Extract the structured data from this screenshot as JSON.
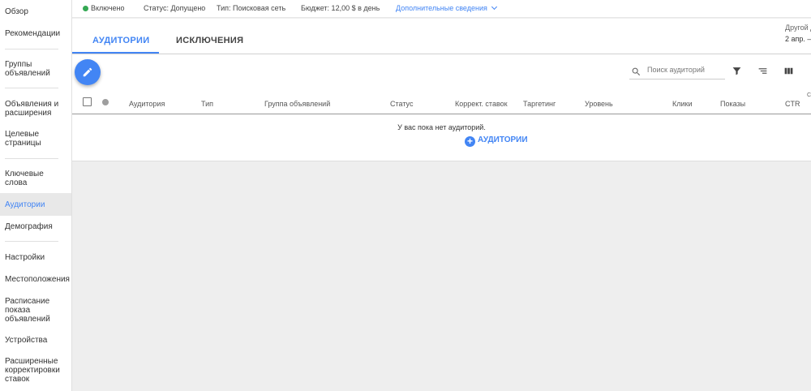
{
  "sidebar": {
    "items": [
      {
        "label": "Обзор"
      },
      {
        "label": "Рекомендации"
      },
      {
        "label": "Группы объявлений"
      },
      {
        "label": "Объявления и расширения"
      },
      {
        "label": "Целевые страницы"
      },
      {
        "label": "Ключевые слова"
      },
      {
        "label": "Аудитории"
      },
      {
        "label": "Демография"
      },
      {
        "label": "Настройки"
      },
      {
        "label": "Местоположения"
      },
      {
        "label": "Расписание показа объявлений"
      },
      {
        "label": "Устройства"
      },
      {
        "label": "Расширенные корректировки ставок"
      }
    ]
  },
  "status_bar": {
    "state": "Включено",
    "status": "Статус: Допущено",
    "type": "Тип: Поисковая сеть",
    "budget": "Бюджет: 12,00 $ в день",
    "more": "Дополнительные сведения"
  },
  "tabs": {
    "audiences": "АУДИТОРИИ",
    "exclusions": "ИСКЛЮЧЕНИЯ"
  },
  "date_range": {
    "label": "Другой д",
    "value": "2 апр. –"
  },
  "toolbar": {
    "search_placeholder": "Поиск аудиторий"
  },
  "table": {
    "columns": [
      "Аудитория",
      "Тип",
      "Группа объявлений",
      "Статус",
      "Коррект. ставок",
      "Таргетинг",
      "Уровень",
      "Клики",
      "Показы",
      "CTR"
    ],
    "clipped_header": "С",
    "empty_message": "У вас пока нет аудиторий.",
    "add_label": "АУДИТОРИИ"
  },
  "colors": {
    "accent": "#4285f4",
    "enabled": "#34a853"
  }
}
